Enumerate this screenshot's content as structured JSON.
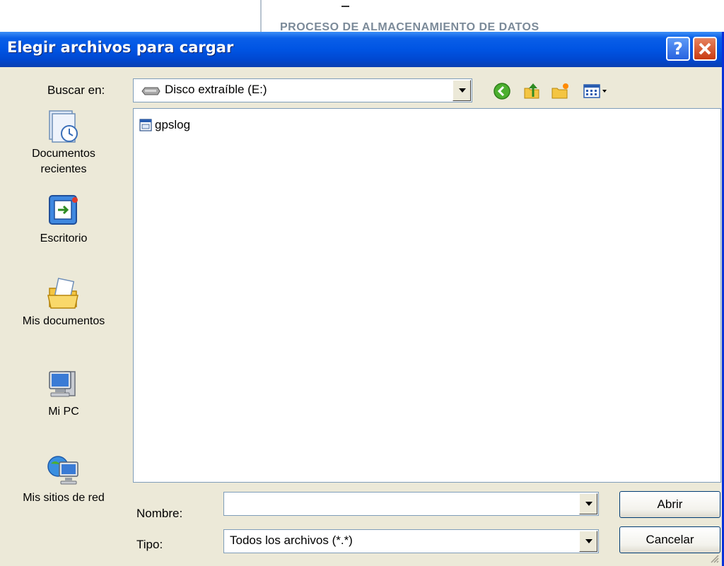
{
  "background_page": {
    "heading": "PROCESO DE ALMACENAMIENTO DE DATOS"
  },
  "dialog": {
    "title": "Elegir archivos para cargar",
    "help_label": "?",
    "close_label": "✕"
  },
  "lookin": {
    "label": "Buscar en:",
    "value": "Disco extraíble (E:)"
  },
  "toolbar": {
    "icons": [
      "back-icon",
      "up-folder-icon",
      "new-folder-icon",
      "view-menu-icon"
    ]
  },
  "places": [
    {
      "label_line1": "Documentos",
      "label_line2": "recientes",
      "icon": "recent-documents-icon"
    },
    {
      "label_line1": "Escritorio",
      "label_line2": "",
      "icon": "desktop-icon"
    },
    {
      "label_line1": "Mis documentos",
      "label_line2": "",
      "icon": "my-documents-icon"
    },
    {
      "label_line1": "Mi PC",
      "label_line2": "",
      "icon": "my-computer-icon"
    },
    {
      "label_line1": "Mis sitios de red",
      "label_line2": "",
      "icon": "network-places-icon"
    }
  ],
  "files": [
    {
      "name": "gpslog",
      "icon": "text-file-icon"
    }
  ],
  "filename": {
    "label": "Nombre:",
    "value": ""
  },
  "filetype": {
    "label": "Tipo:",
    "value": "Todos los archivos (*.*)"
  },
  "buttons": {
    "open": "Abrir",
    "cancel": "Cancelar"
  },
  "colors": {
    "titlebar": "#0054e3",
    "dialog_bg": "#ece9d8",
    "field_border": "#7f9db9",
    "close_red": "#c93a12"
  }
}
